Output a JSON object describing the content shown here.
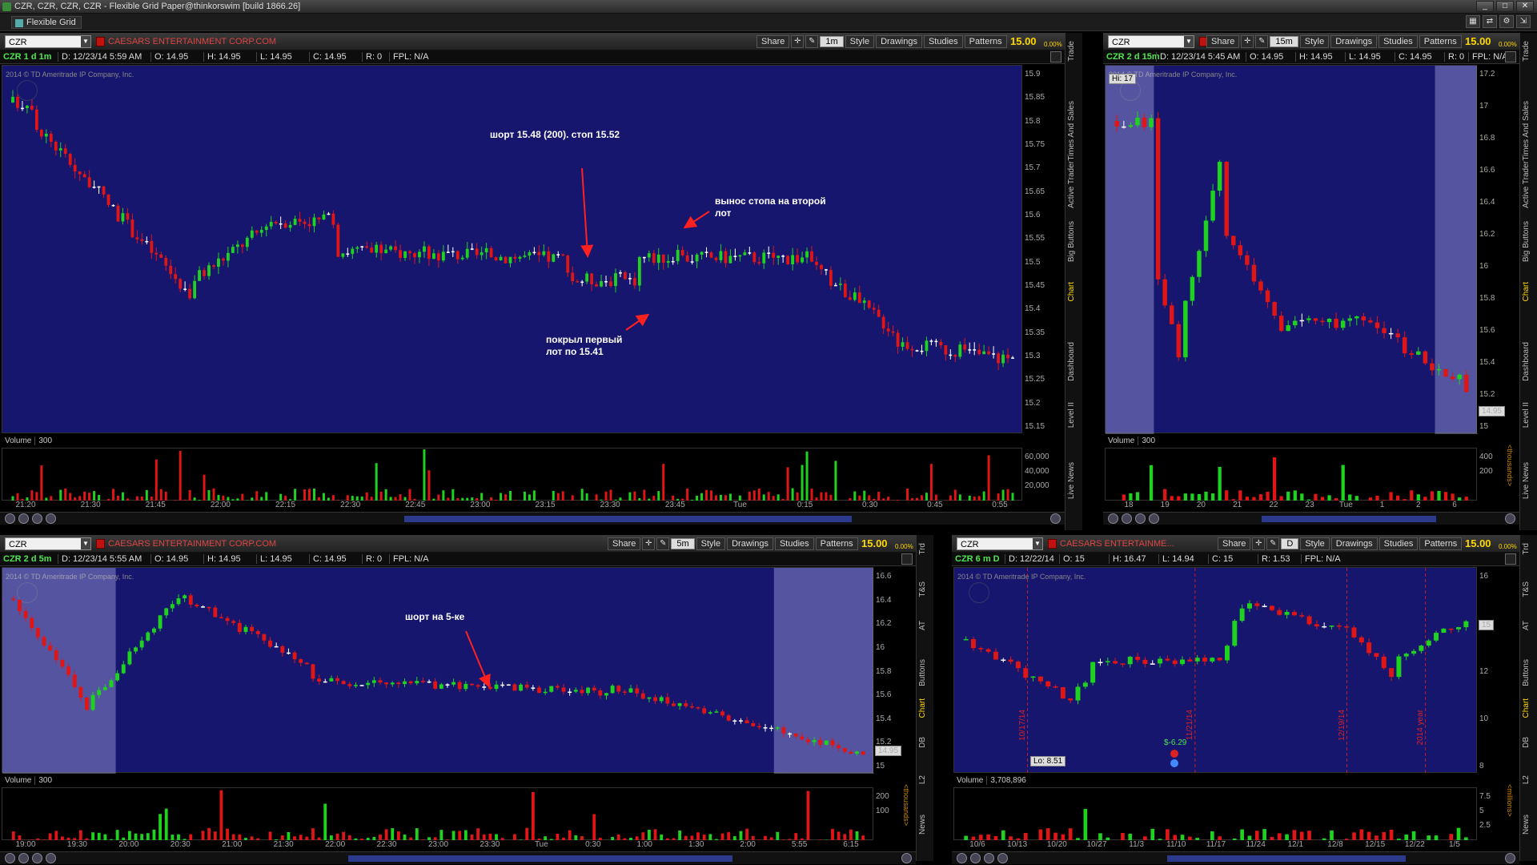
{
  "window": {
    "title": "CZR, CZR, CZR, CZR - Flexible Grid Paper@thinkorswim [build 1866.26]",
    "grid_tab": "Flexible Grid"
  },
  "toolbar": {
    "share": "Share",
    "style": "Style",
    "drawings": "Drawings",
    "studies": "Studies",
    "patterns": "Patterns",
    "company": "CAESARS ENTERTAINMENT CORP.COM",
    "company_short": "CAESARS ENTERTAINME...",
    "price": "15.00",
    "pct": "0.00%"
  },
  "watermark": "2014 © TD Ameritrade IP Company, Inc.",
  "colors": {
    "bg": "#16166e",
    "up": "#1fd21f",
    "down": "#e01515",
    "flat": "#ffffff",
    "accent": "#ffd800"
  },
  "panels": [
    {
      "id": "p1",
      "symbol": "CZR",
      "agg": "1m",
      "label": "CZR 1 d 1m",
      "date": "D: 12/23/14 5:59 AM",
      "o": "O: 14.95",
      "h": "H: 14.95",
      "l": "L: 14.95",
      "c": "C: 14.95",
      "r": "R: 0",
      "fpl": "FPL: N/A",
      "vol_label": "Volume",
      "vol_val": "300",
      "yticks": [
        "15.9",
        "15.85",
        "15.8",
        "15.75",
        "15.7",
        "15.65",
        "15.6",
        "15.55",
        "15.5",
        "15.45",
        "15.4",
        "15.35",
        "15.3",
        "15.25",
        "15.2",
        "15.15"
      ],
      "vticks": [
        "60,000",
        "40,000",
        "20,000"
      ],
      "xticks": [
        "21:20",
        "21:30",
        "21:45",
        "22:00",
        "22:15",
        "22:30",
        "22:45",
        "23:00",
        "23:15",
        "23:30",
        "23:45",
        "Tue",
        "0:15",
        "0:30",
        "0:45",
        "0:55"
      ],
      "tabs": [
        "Trade",
        "Times And Sales",
        "Active Trader",
        "Big Buttons",
        "Chart",
        "Dashboard",
        "Level II",
        "Live News"
      ],
      "active_tab": "Chart"
    },
    {
      "id": "p2",
      "symbol": "CZR",
      "agg": "15m",
      "label": "CZR 2 d 15m",
      "date": "D: 12/23/14 5:45 AM",
      "o": "O: 14.95",
      "h": "H: 14.95",
      "l": "L: 14.95",
      "c": "C: 14.95",
      "r": "R: 0",
      "fpl": "FPL: N/A",
      "vol_label": "Volume",
      "vol_val": "300",
      "yticks": [
        "17.2",
        "17",
        "16.8",
        "16.6",
        "16.4",
        "16.2",
        "16",
        "15.8",
        "15.6",
        "15.4",
        "15.2",
        "15"
      ],
      "vticks": [
        "400",
        "200"
      ],
      "vunit": "<thousands>",
      "xticks": [
        "18",
        "19",
        "20",
        "21",
        "22",
        "23",
        "Tue",
        "1",
        "2",
        "6"
      ],
      "hi_label": "Hi: 17",
      "last": "14.95",
      "tabs": [
        "Trade",
        "Times And Sales",
        "Active Trader",
        "Big Buttons",
        "Chart",
        "Dashboard",
        "Level II",
        "Live News"
      ],
      "active_tab": "Chart"
    },
    {
      "id": "p3",
      "symbol": "CZR",
      "agg": "5m",
      "label": "CZR 2 d 5m",
      "date": "D: 12/23/14 5:55 AM",
      "o": "O: 14.95",
      "h": "H: 14.95",
      "l": "L: 14.95",
      "c": "C: 14.95",
      "r": "R: 0",
      "fpl": "FPL: N/A",
      "vol_label": "Volume",
      "vol_val": "300",
      "yticks": [
        "16.6",
        "16.4",
        "16.2",
        "16",
        "15.8",
        "15.6",
        "15.4",
        "15.2",
        "15"
      ],
      "vticks": [
        "200",
        "100"
      ],
      "vunit": "<thousands>",
      "xticks": [
        "19:00",
        "19:30",
        "20:00",
        "20:30",
        "21:00",
        "21:30",
        "22:00",
        "22:30",
        "23:00",
        "23:30",
        "Tue",
        "0:30",
        "1:00",
        "1:30",
        "2:00",
        "5:55",
        "6:15"
      ],
      "last": "14.95",
      "tabs": [
        "Trd",
        "T&S",
        "AT",
        "Buttons",
        "Chart",
        "DB",
        "L2",
        "News"
      ],
      "active_tab": "Chart"
    },
    {
      "id": "p4",
      "symbol": "CZR",
      "agg": "D",
      "label": "CZR 6 m D",
      "date": "D: 12/22/14",
      "o": "O: 15",
      "h": "H: 16.47",
      "l": "L: 14.94",
      "c": "C: 15",
      "r": "R: 1.53",
      "fpl": "FPL: N/A",
      "vol_label": "Volume",
      "vol_val": "3,708,896",
      "yticks": [
        "16",
        "14",
        "12",
        "10",
        "8"
      ],
      "vticks": [
        "7.5",
        "5",
        "2.5"
      ],
      "vunit": "<millions>",
      "xticks": [
        "10/6",
        "10/13",
        "10/20",
        "10/27",
        "11/3",
        "11/10",
        "11/17",
        "11/24",
        "12/1",
        "12/8",
        "12/15",
        "12/22",
        "1/5"
      ],
      "lo_label": "Lo: 8.51",
      "last": "15",
      "div_label": "$-6.29",
      "vlines": [
        "10/17/14",
        "11/21/14",
        "12/19/14",
        "2014 year"
      ],
      "tabs": [
        "Trd",
        "T&S",
        "AT",
        "Buttons",
        "Chart",
        "DB",
        "L2",
        "News"
      ],
      "active_tab": "Chart"
    }
  ],
  "annotations": {
    "a1": "шорт 15.48 (200). стоп 15.52",
    "a2": "вынос стопа на второй",
    "a2b": "лот",
    "a3": "покрыл первый",
    "a3b": "лот по 15.41",
    "a4": "шорт на 5-ке"
  }
}
